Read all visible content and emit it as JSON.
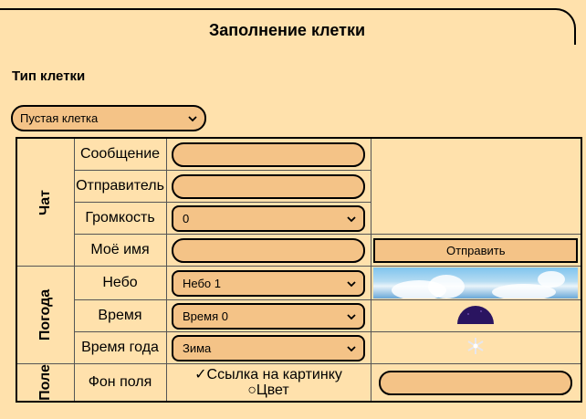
{
  "header": {
    "title": "Заполнение клетки"
  },
  "cell_type": {
    "label": "Тип клетки",
    "selected": "Пустая клетка"
  },
  "groups": {
    "chat": "Чат",
    "weather": "Погода",
    "field": "Поле"
  },
  "chat": {
    "message_label": "Сообщение",
    "sender_label": "Отправитель",
    "volume_label": "Громкость",
    "volume_value": "0",
    "myname_label": "Моё имя",
    "send_button": "Отправить"
  },
  "weather": {
    "sky_label": "Небо",
    "sky_value": "Небо 1",
    "time_label": "Время",
    "time_value": "Время 0",
    "season_label": "Время года",
    "season_value": "Зима"
  },
  "field": {
    "bg_label": "Фон поля",
    "option_link": "✓Ссылка на картинку",
    "option_color": "○Цвет"
  },
  "colors": {
    "background": "#ffe1ac",
    "control": "#f4c387",
    "night_icon": "#2a1460"
  }
}
